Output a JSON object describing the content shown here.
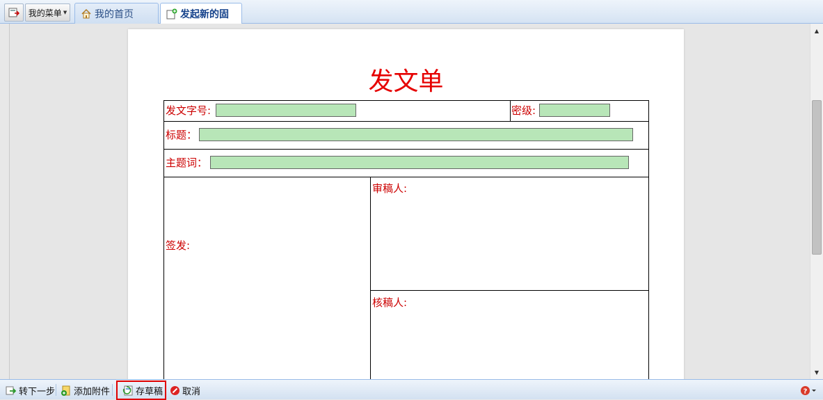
{
  "topbar": {
    "menu_label": "我的菜单",
    "tabs": [
      {
        "label": "我的首页",
        "icon": "home-icon"
      },
      {
        "label": "发起新的固",
        "icon": "new-doc-icon"
      }
    ]
  },
  "document": {
    "title": "发文单",
    "fields": {
      "doc_number_label": "发文字号:",
      "doc_number_value": "",
      "secret_level_label": "密级:",
      "secret_level_value": "",
      "subject_label": "标题：",
      "subject_value": "",
      "keywords_label": "主题词：",
      "keywords_value": "",
      "sign_label": "签发:",
      "reviewer_label": "审稿人:",
      "checker_label": "核稿人:"
    }
  },
  "toolbar": {
    "next_step": "转下一步",
    "add_attachment": "添加附件",
    "save_draft": "存草稿",
    "cancel": "取消"
  },
  "colors": {
    "label_red": "#cc0000",
    "title_red": "#e60000",
    "field_green": "#b8e6b8",
    "highlight": "#e00000"
  }
}
